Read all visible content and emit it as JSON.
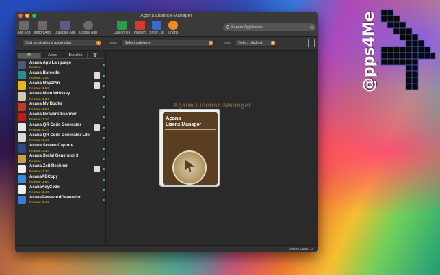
{
  "window": {
    "title": "Açana License Manager"
  },
  "toolbar": {
    "buttons": [
      {
        "label": "Add App",
        "icon": "add-app-icon",
        "color": "#6a6a6a"
      },
      {
        "label": "Import App",
        "icon": "import-app-icon",
        "color": "#6a6a6a"
      },
      {
        "label": "Duplicate App",
        "icon": "duplicate-app-icon",
        "color": "#5c5c88"
      },
      {
        "label": "Update App",
        "icon": "update-app-icon",
        "color": "#6a6a6a"
      },
      {
        "label": "Categories",
        "icon": "categories-icon",
        "color": "#2c9a4a"
      },
      {
        "label": "Platform",
        "icon": "platform-icon",
        "color": "#d33a2a"
      },
      {
        "label": "Show List",
        "icon": "show-list-icon",
        "color": "#3a6ad0"
      },
      {
        "label": "Charts",
        "icon": "charts-icon",
        "color": "#f08a24"
      }
    ],
    "search_placeholder": "Search Application"
  },
  "filterbar": {
    "sort_label": "Sort applications ascending",
    "filter_label_1": "Filter",
    "category_value": "Select category",
    "filter_label_2": "Filter",
    "platform_value": "Select platform"
  },
  "sidebar": {
    "tabs": [
      "All",
      "Apps",
      "Bundles"
    ],
    "apps": [
      {
        "name": "Acana App Language",
        "release": "Release:",
        "icon_color": "#4a5a7a",
        "doc": false
      },
      {
        "name": "Acana Barcode",
        "release": "Release: 1.3.0",
        "icon_color": "#2a8a9a",
        "doc": true
      },
      {
        "name": "Acana Map2Pin",
        "release": "Release: 1.6.0",
        "icon_color": "#e8b820",
        "doc": true
      },
      {
        "name": "Acana Mein Whiskey",
        "release": "Release: 1.3.0",
        "icon_color": "#d0c8b0",
        "doc": false
      },
      {
        "name": "Acana My Books",
        "release": "Release: 1.6.0",
        "icon_color": "#c03a2a",
        "doc": false
      },
      {
        "name": "Acana Network Scanner",
        "release": "Release: 1.1.0",
        "icon_color": "#c81818",
        "doc": false
      },
      {
        "name": "Acana QR Code Generator",
        "release": "Release: 4.7.0",
        "icon_color": "#e8e8e8",
        "doc": true
      },
      {
        "name": "Acana QR Code Generator Lite",
        "release": "Release: 1.4.0",
        "icon_color": "#d8d8d8",
        "doc": false
      },
      {
        "name": "Acana Screen Capture",
        "release": "Release: 1.3.0",
        "icon_color": "#2a4a8a",
        "doc": false
      },
      {
        "name": "Acana Serial Generator 3",
        "release": "Release:",
        "icon_color": "#c8a050",
        "doc": false
      },
      {
        "name": "Acana Zeit Rechner",
        "release": "Release: 2.3.0",
        "icon_color": "#f0f0f0",
        "doc": true
      },
      {
        "name": "AcanaABCopy",
        "release": "Release: 1.6.0",
        "icon_color": "#3a8ae0",
        "doc": false
      },
      {
        "name": "AcanaKeyCode",
        "release": "Release: 1.4.0",
        "icon_color": "#f0f0f0",
        "doc": false
      },
      {
        "name": "AcanaPasswordGenerator",
        "release": "Release: 1.4.0",
        "icon_color": "#3a7ad0",
        "doc": false
      }
    ],
    "status_color": "#3bd14a"
  },
  "main": {
    "title": "Açana License Manager",
    "box_line1": "Açana",
    "box_line2": "Lizenz Manager"
  },
  "status": {
    "license_count": "License Count: 14"
  },
  "watermark": {
    "text": "@pps4Me"
  }
}
